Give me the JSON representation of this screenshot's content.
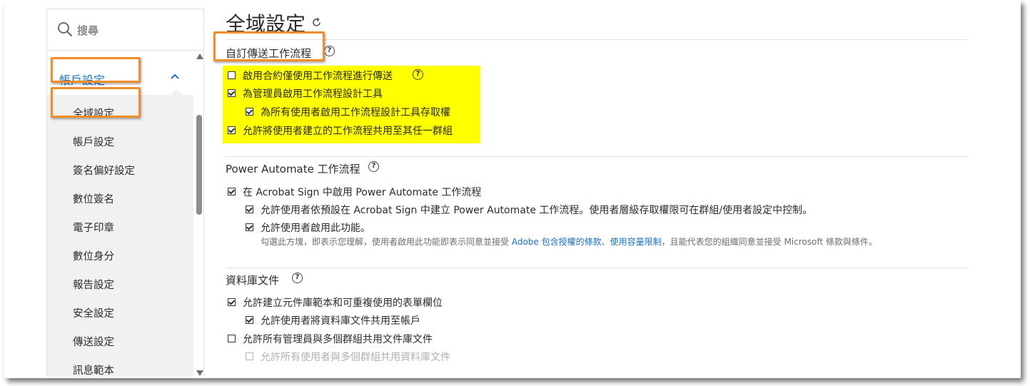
{
  "sidebar": {
    "search_placeholder": "搜尋",
    "section_title": "帳戶設定",
    "items": [
      {
        "label": "全域設定"
      },
      {
        "label": "帳戶設定"
      },
      {
        "label": "簽名偏好設定"
      },
      {
        "label": "數位簽名"
      },
      {
        "label": "電子印章"
      },
      {
        "label": "數位身分"
      },
      {
        "label": "報告設定"
      },
      {
        "label": "安全設定"
      },
      {
        "label": "傳送設定"
      },
      {
        "label": "訊息範本"
      }
    ]
  },
  "main": {
    "title": "全域設定",
    "sections": {
      "custom_workflow": {
        "heading": "自訂傳送工作流程",
        "options": [
          {
            "label": "啟用合約僅使用工作流程進行傳送",
            "checked": false
          },
          {
            "label": "為管理員啟用工作流程設計工具",
            "checked": true
          },
          {
            "label": "為所有使用者啟用工作流程設計工具存取權",
            "checked": true
          },
          {
            "label": "允許將使用者建立的工作流程共用至其任一群組",
            "checked": true
          }
        ]
      },
      "power_automate": {
        "heading": "Power Automate 工作流程",
        "options": [
          {
            "label": "在 Acrobat Sign 中啟用 Power Automate 工作流程",
            "checked": true
          },
          {
            "label": "允許使用者依預設在 Acrobat Sign 中建立 Power Automate 工作流程。使用者層級存取權限可在群組/使用者設定中控制。",
            "checked": true
          },
          {
            "label": "允許使用者啟用此功能。",
            "checked": true
          }
        ],
        "note_prefix": "勾選此方塊，即表示您理解，使用者啟用此功能即表示同意並接受 ",
        "note_link1": "Adobe 包含授權的條款",
        "note_sep": "、",
        "note_link2": "使用容量限制",
        "note_suffix": "，且能代表您的組織同意並接受 Microsoft 條款與條件。"
      },
      "library": {
        "heading": "資料庫文件",
        "options": [
          {
            "label": "允許建立元件庫範本和可重複使用的表單欄位",
            "checked": true
          },
          {
            "label": "允許使用者將資料庫文件共用至帳戶",
            "checked": true
          },
          {
            "label": "允許所有管理員與多個群組共用文件庫文件",
            "checked": false
          },
          {
            "label": "允許所有使用者與多個群組共用資料庫文件",
            "checked": false,
            "disabled": true
          }
        ]
      }
    }
  },
  "colors": {
    "accent": "#1a6fbf",
    "highlight": "#ffff00",
    "callout": "#f08c2a"
  }
}
